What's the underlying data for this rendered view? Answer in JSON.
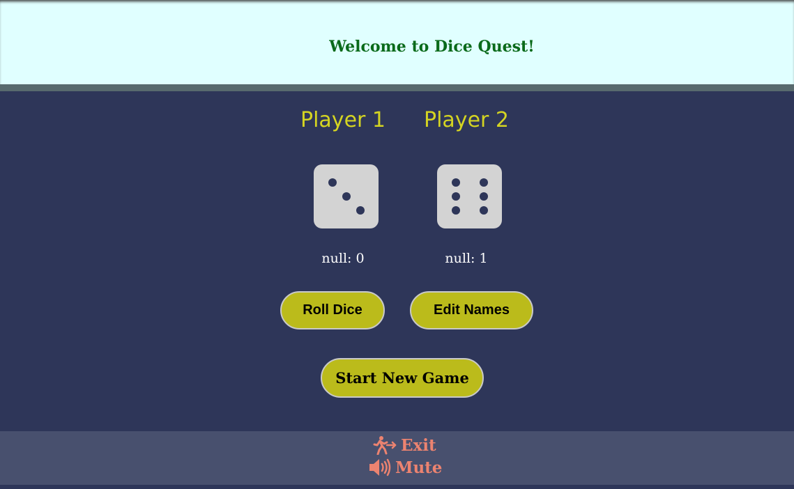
{
  "header": {
    "title": "Welcome to Dice Quest!"
  },
  "players": [
    {
      "name": "Player 1",
      "die_value": 3,
      "score_label": "null: 0"
    },
    {
      "name": "Player 2",
      "die_value": 6,
      "score_label": "null: 1"
    }
  ],
  "buttons": {
    "roll": "Roll Dice",
    "edit_names": "Edit Names",
    "new_game": "Start New Game"
  },
  "footer": {
    "exit_label": "Exit",
    "exit_icon": "person-running-exit-icon",
    "mute_label": "Mute",
    "mute_icon": "speaker-volume-icon"
  },
  "colors": {
    "header_bg": "#e0ffff",
    "header_text": "#0a6a1a",
    "main_bg": "#2e3659",
    "player_name": "#d4d422",
    "button_bg": "#bbbb1b",
    "footer_bg": "#48506e",
    "footer_text": "#ec8370"
  }
}
